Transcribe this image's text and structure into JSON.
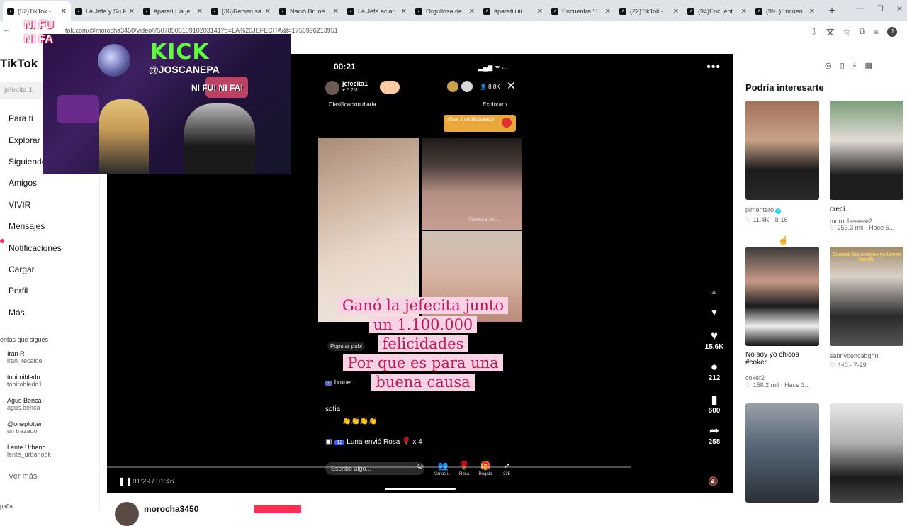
{
  "browser": {
    "tabs": [
      {
        "title": "(52)TikTok - ",
        "active": true
      },
      {
        "title": "La Jefa y Su F"
      },
      {
        "title": "#parati | la je"
      },
      {
        "title": "(36)Recien sa"
      },
      {
        "title": "Nació Brune"
      },
      {
        "title": "La Jefa aclar"
      },
      {
        "title": "Orgullosa de"
      },
      {
        "title": "#paratiiiiiii"
      },
      {
        "title": "Encuentra 'E"
      },
      {
        "title": "(22)TikTok - "
      },
      {
        "title": "(94)Encuent"
      },
      {
        "title": "(99+)Encuen"
      }
    ],
    "url": "tok.com/@morocha3450/video/7507850610910203141?q=LA%20JEFECITA&t=1756996213951",
    "profile_initial": "J"
  },
  "sidebar": {
    "logo": "TikTok",
    "search_placeholder": "jefecita 1",
    "nav": [
      "Para ti",
      "Explorar",
      "Siguiendo",
      "Amigos",
      "VIVIR",
      "Mensajes",
      "Notificaciones",
      "Cargar",
      "Perfil",
      "Más"
    ],
    "following_title": "entas que sigues",
    "following": [
      {
        "name": "Irán R",
        "handle": "iran_recalde"
      },
      {
        "name": "tobiroibledo",
        "handle": "tobirobledo1"
      },
      {
        "name": "Agus Benca",
        "handle": "agus.benca"
      },
      {
        "name": "@oneplotter",
        "handle": "un trazador"
      },
      {
        "name": "Lente Urbano",
        "handle": "lente_urbanook"
      }
    ],
    "see_more": "Ver más",
    "region": "paña"
  },
  "overlay": {
    "brand": "KICK",
    "handle": "@JOSCANEPA",
    "badge": "NI FU NI FA",
    "inner_badge": "NI FU! NI FA!"
  },
  "video": {
    "phone_time": "00:21",
    "phone_status": "▂▄▆ ᯤ ▭",
    "host_name": "jefecita1_",
    "host_likes": "♥ 5.2M",
    "viewer_count": "👤 8.8K",
    "ranking": "Clasificación diaria",
    "explore": "Explorar ›",
    "phase_badge": "¡Fase 1 desbloqueada!",
    "guest_label": "Vanesa Ad...",
    "caption_lines": [
      "Ganó la jefecita junto",
      "un  1.100.000",
      "felicidades",
      "Por que es para una",
      "buena causa"
    ],
    "popular": "Popular publ",
    "chat": [
      {
        "level": "1",
        "user": "brune..."
      },
      {
        "user": "sofia",
        "text": "👏👏👏👏"
      },
      {
        "level": "12",
        "user": "Luna",
        "text": "envió Rosa 🌹 x 4"
      }
    ],
    "comment_placeholder": "Escribe algo...",
    "bottom_actions": [
      {
        "icon": "👥",
        "label": "Varios i..."
      },
      {
        "icon": "🌹",
        "label": "Rosa"
      },
      {
        "icon": "🎁",
        "label": "Regalo"
      },
      {
        "icon": "↗",
        "label": "335"
      }
    ],
    "playback_time": "01:29 / 01:46",
    "likes": "15.6K",
    "comments": "212",
    "saves": "600",
    "shares": "258"
  },
  "recommendations": {
    "title": "Podría interesarte",
    "items": [
      {
        "user": "pimentero",
        "likes": "11.4K",
        "date": "8-16",
        "verified": true
      },
      {
        "title": "crecí...",
        "user": "morocheeeee2",
        "likes": "253.3 mil",
        "date": "Hace 5..."
      },
      {
        "title": "No soy yo chicos #coker",
        "user": "coker2",
        "likes": "158.2 mil",
        "date": "Hace 3..."
      },
      {
        "user": "sabrivbencabghnj",
        "likes": "440",
        "date": "7-29",
        "caption": "Cuando tus amigos ya tienen bendis"
      },
      {},
      {}
    ]
  },
  "below": {
    "username": "morocha3450"
  }
}
